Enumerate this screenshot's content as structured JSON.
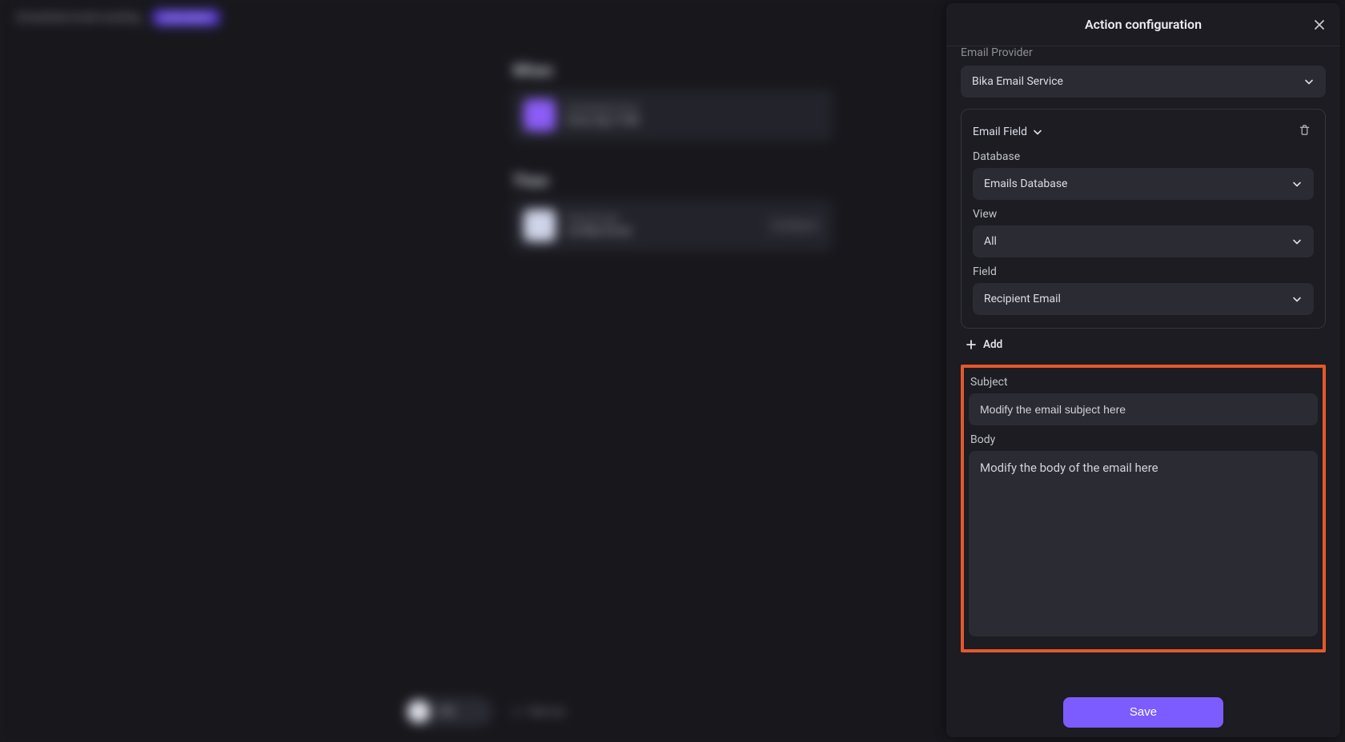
{
  "background": {
    "breadcrumb": "Scheduled email sending",
    "badge": "Automation",
    "when": {
      "title": "When",
      "line1": "Scheduled time",
      "line2": "Every day, 9 AM"
    },
    "then": {
      "title": "Then",
      "line1": "Send Email",
      "line2": "via Bika Email",
      "right": "Configure"
    },
    "toggle": "ON",
    "test_run": "Test run"
  },
  "panel": {
    "title": "Action configuration",
    "email_provider_label": "Email Provider",
    "email_provider_value": "Bika Email Service",
    "field_block": {
      "name": "Email Field",
      "database_label": "Database",
      "database_value": "Emails Database",
      "view_label": "View",
      "view_value": "All",
      "field_label": "Field",
      "field_value": "Recipient Email"
    },
    "add_label": "Add",
    "subject_label": "Subject",
    "subject_value": "Modify the email subject here",
    "body_label": "Body",
    "body_value": "Modify the body of the email here",
    "save_label": "Save"
  }
}
